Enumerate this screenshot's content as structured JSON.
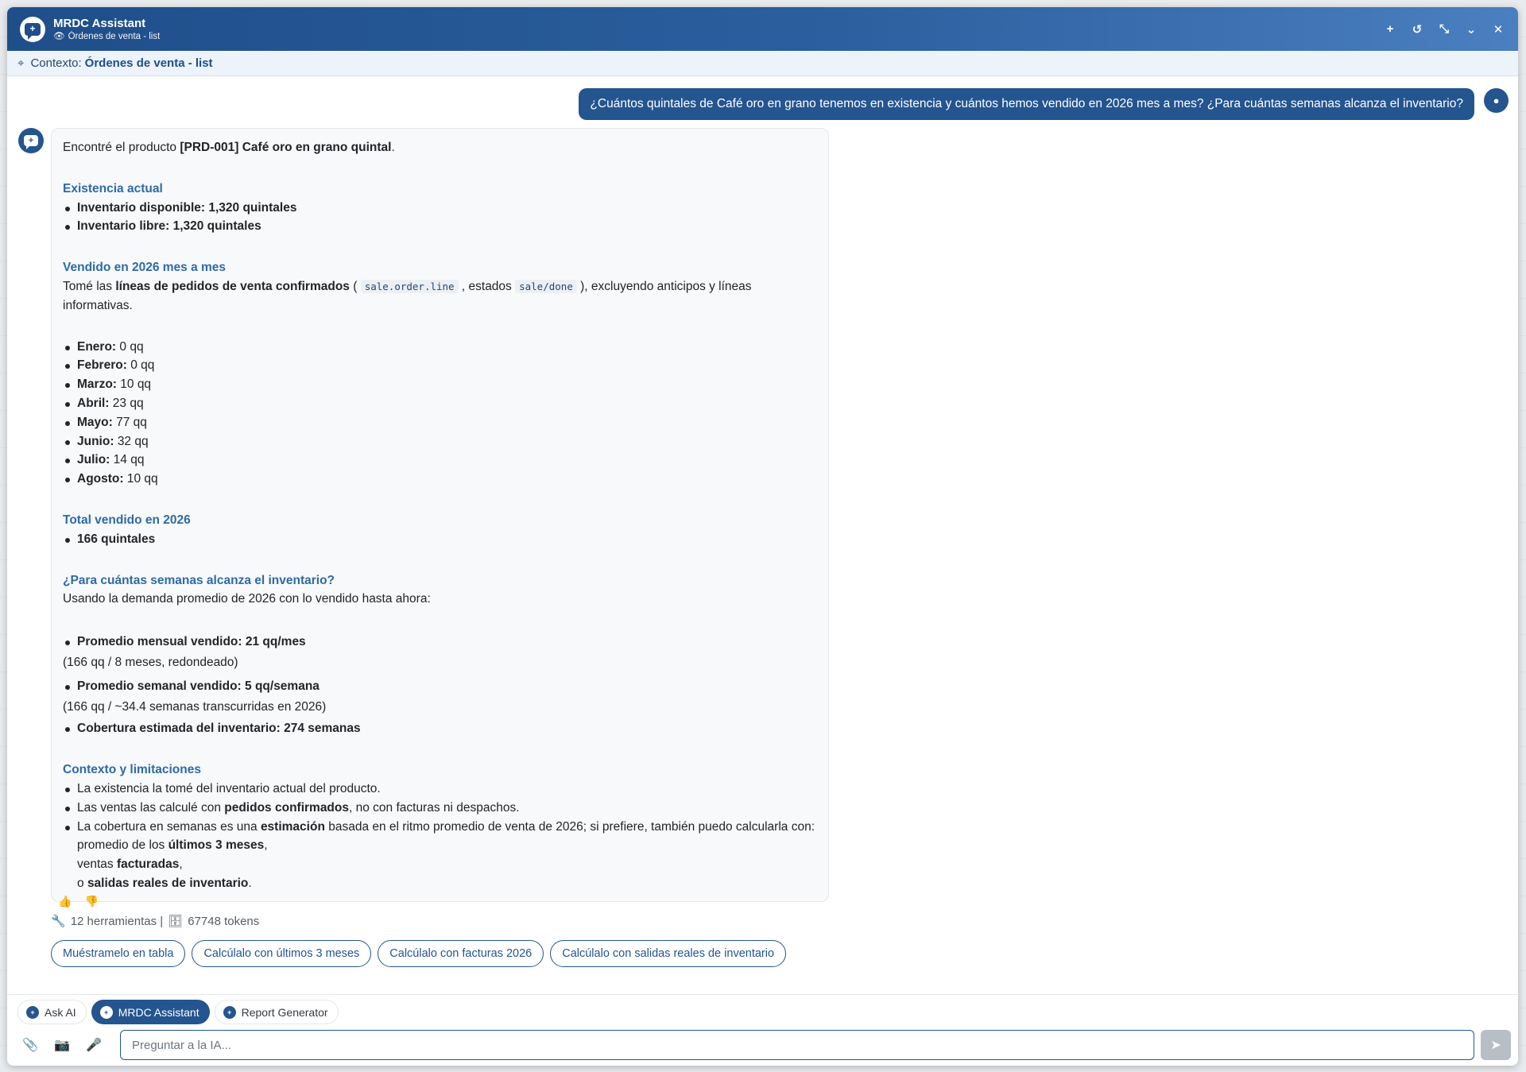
{
  "header": {
    "title": "MRDC Assistant",
    "subtitle": "Órdenes de venta - list",
    "actions": [
      "new-chat",
      "history",
      "minimize",
      "collapse",
      "close"
    ]
  },
  "context": {
    "label": "Contexto:",
    "value": "Órdenes de venta - list"
  },
  "user_message": "¿Cuántos quintales de Café oro en grano tenemos en existencia y cuántos hemos vendido en 2026 mes a mes? ¿Para cuántas semanas alcanza el inventario?",
  "bot": {
    "intro_pre": "Encontré el producto ",
    "intro_product": "[PRD-001] Café oro en grano quintal",
    "intro_post": ".",
    "stock": {
      "heading": "Existencia actual",
      "items": [
        "Inventario disponible: 1,320 quintales",
        "Inventario libre: 1,320 quintales"
      ]
    },
    "monthly": {
      "heading": "Vendido en 2026 mes a mes",
      "desc_pre": "Tomé las ",
      "desc_bold": "líneas de pedidos de venta confirmados",
      "desc_mid1": " ( ",
      "desc_code1": "sale.order.line",
      "desc_mid2": " , estados ",
      "desc_code2": "sale/done",
      "desc_post": " ), excluyendo anticipos y líneas informativas.",
      "months": [
        {
          "label": "Enero:",
          "value": "0 qq"
        },
        {
          "label": "Febrero:",
          "value": "0 qq"
        },
        {
          "label": "Marzo:",
          "value": "10 qq"
        },
        {
          "label": "Abril:",
          "value": "23 qq"
        },
        {
          "label": "Mayo:",
          "value": "77 qq"
        },
        {
          "label": "Junio:",
          "value": "32 qq"
        },
        {
          "label": "Julio:",
          "value": "14 qq"
        },
        {
          "label": "Agosto:",
          "value": "10 qq"
        }
      ]
    },
    "total": {
      "heading": "Total vendido en 2026",
      "value": "166 quintales"
    },
    "coverage": {
      "heading": "¿Para cuántas semanas alcanza el inventario?",
      "desc": "Usando la demanda promedio de 2026 con lo vendido hasta ahora:",
      "monthly_avg": "Promedio mensual vendido: 21 qq/mes",
      "monthly_note": "(166 qq / 8 meses, redondeado)",
      "weekly_avg": "Promedio semanal vendido: 5 qq/semana",
      "weekly_note": "(166 qq / ~34.4 semanas transcurridas en 2026)",
      "estimate": "Cobertura estimada del inventario: 274 semanas"
    },
    "limits": {
      "heading": "Contexto y limitaciones",
      "l1": "La existencia la tomé del inventario actual del producto.",
      "l2_pre": "Las ventas las calculé con ",
      "l2_bold": "pedidos confirmados",
      "l2_post": ", no con facturas ni despachos.",
      "l3_pre": "La cobertura en semanas es una ",
      "l3_bold": "estimación",
      "l3_post": " basada en el ritmo promedio de venta de 2026; si prefiere, también puedo calcularla con:",
      "l4_pre": "promedio de los ",
      "l4_bold": "últimos 3 meses",
      "l4_post": ",",
      "l5_pre": "ventas ",
      "l5_bold": "facturadas",
      "l5_post": ",",
      "l6_pre": "o ",
      "l6_bold": "salidas reales de inventario",
      "l6_post": "."
    }
  },
  "stats": {
    "tools": "12 herramientas |",
    "tokens": "67748 tokens"
  },
  "suggestions": [
    "Muéstramelo en tabla",
    "Calcúlalo con últimos 3 meses",
    "Calcúlalo con facturas 2026",
    "Calcúlalo con salidas reales de inventario"
  ],
  "tabs": [
    {
      "label": "Ask AI",
      "active": false
    },
    {
      "label": "MRDC Assistant",
      "active": true
    },
    {
      "label": "Report Generator",
      "active": false
    }
  ],
  "input": {
    "placeholder": "Preguntar a la IA..."
  },
  "colors": {
    "primary": "#24558f",
    "header_start": "#1f4e8a",
    "section_heading": "#2e6aa6"
  }
}
